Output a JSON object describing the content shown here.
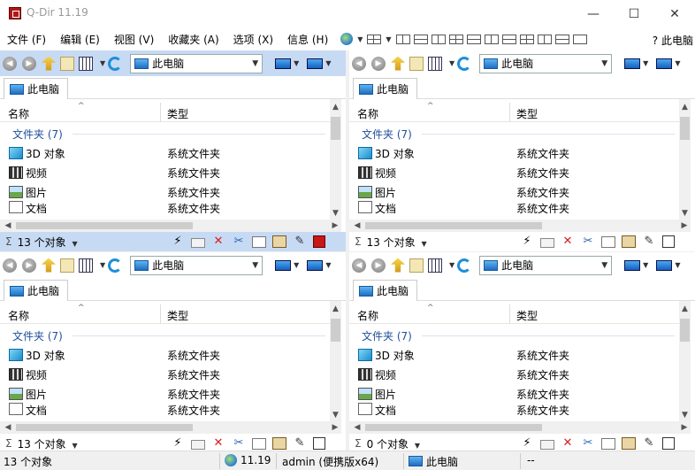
{
  "window": {
    "title": "Q-Dir 11.19",
    "minimize": "—",
    "maximize": "☐",
    "close": "✕"
  },
  "menu": {
    "items": [
      "文件 (F)",
      "编辑 (E)",
      "视图 (V)",
      "收藏夹 (A)",
      "选项 (X)",
      "信息 (H)"
    ],
    "help_label": "此电脑"
  },
  "panes": [
    {
      "address": "此电脑",
      "tab": "此电脑",
      "columns": {
        "name": "名称",
        "type": "类型"
      },
      "group": "文件夹 (7)",
      "rows": [
        {
          "name": "3D 对象",
          "type": "系统文件夹",
          "icon": "3d-objects-icon"
        },
        {
          "name": "视频",
          "type": "系统文件夹",
          "icon": "video-icon"
        },
        {
          "name": "图片",
          "type": "系统文件夹",
          "icon": "pictures-icon"
        },
        {
          "name": "文档",
          "type": "系统文件夹",
          "icon": "documents-icon"
        }
      ],
      "status": "13 个对象"
    },
    {
      "address": "此电脑",
      "tab": "此电脑",
      "columns": {
        "name": "名称",
        "type": "类型"
      },
      "group": "文件夹 (7)",
      "rows": [
        {
          "name": "3D 对象",
          "type": "系统文件夹",
          "icon": "3d-objects-icon"
        },
        {
          "name": "视频",
          "type": "系统文件夹",
          "icon": "video-icon"
        },
        {
          "name": "图片",
          "type": "系统文件夹",
          "icon": "pictures-icon"
        },
        {
          "name": "文档",
          "type": "系统文件夹",
          "icon": "documents-icon"
        }
      ],
      "status": "13 个对象"
    },
    {
      "address": "此电脑",
      "tab": "此电脑",
      "columns": {
        "name": "名称",
        "type": "类型"
      },
      "group": "文件夹 (7)",
      "rows": [
        {
          "name": "3D 对象",
          "type": "系统文件夹",
          "icon": "3d-objects-icon"
        },
        {
          "name": "视频",
          "type": "系统文件夹",
          "icon": "video-icon"
        },
        {
          "name": "图片",
          "type": "系统文件夹",
          "icon": "pictures-icon"
        },
        {
          "name": "文档",
          "type": "系统文件夹",
          "icon": "documents-icon"
        }
      ],
      "status": "13 个对象"
    },
    {
      "address": "此电脑",
      "tab": "此电脑",
      "columns": {
        "name": "名称",
        "type": "类型"
      },
      "group": "文件夹 (7)",
      "rows": [
        {
          "name": "3D 对象",
          "type": "系统文件夹",
          "icon": "3d-objects-icon"
        },
        {
          "name": "视频",
          "type": "系统文件夹",
          "icon": "video-icon"
        },
        {
          "name": "图片",
          "type": "系统文件夹",
          "icon": "pictures-icon"
        },
        {
          "name": "文档",
          "type": "系统文件夹",
          "icon": "documents-icon"
        }
      ],
      "status": "0 个对象"
    }
  ],
  "bottom_status": {
    "objects": "13 个对象",
    "version": "11.19",
    "user": "admin (便携版x64)",
    "location": "此电脑",
    "extra": "--"
  },
  "colors": {
    "active_pane": "#c7daf3",
    "group_text": "#1f4e9c",
    "delete_red": "#d61d1d"
  }
}
